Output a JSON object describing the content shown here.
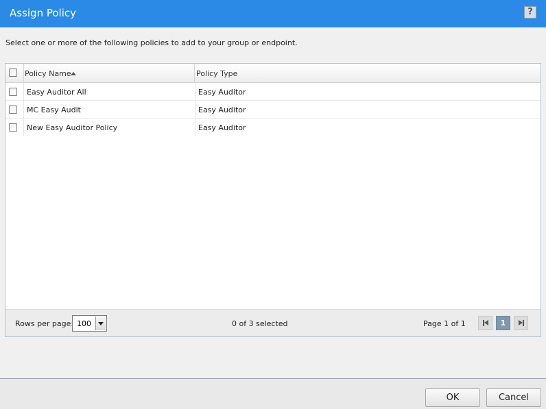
{
  "dialog": {
    "title": "Assign Policy",
    "help_label": "?"
  },
  "instructions": "Select one or more of the following policies to add to your group or endpoint.",
  "table": {
    "columns": [
      {
        "label": "Policy Name",
        "sort": "ascending"
      },
      {
        "label": "Policy Type"
      }
    ],
    "rows": [
      {
        "name": "Easy Auditor All",
        "type": "Easy Auditor",
        "checked": false
      },
      {
        "name": "MC Easy Audit",
        "type": "Easy Auditor",
        "checked": false
      },
      {
        "name": "New Easy Auditor Policy",
        "type": "Easy Auditor",
        "checked": false
      }
    ]
  },
  "footer": {
    "rows_per_page_label": "Rows per page:",
    "rows_per_page_value": "100",
    "selection_status": "0 of 3 selected",
    "page_info": "Page 1 of 1",
    "current_page": "1"
  },
  "buttons": {
    "ok": "OK",
    "cancel": "Cancel"
  },
  "colors": {
    "title_bar": "#2a8ae6",
    "current_page_button": "#7f98ad"
  }
}
